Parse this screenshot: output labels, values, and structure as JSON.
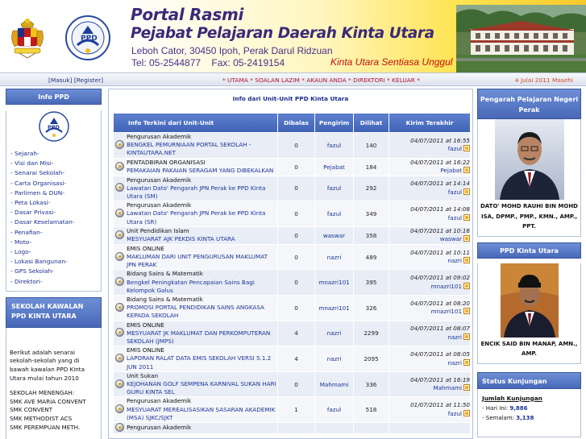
{
  "header": {
    "title": "Portal Rasmi",
    "subtitle": "Pejabat Pelajaran Daerah Kinta Utara",
    "address": "Leboh Cator, 30450 Ipoh, Perak Darul Ridzuan",
    "tel": "Tel: 05-2544877    Fax: 05-2419154",
    "motto": "Kinta Utara Sentiasa Unggul"
  },
  "nav": {
    "masuk": "[Masuk]",
    "register": "[Register]",
    "menu": [
      "* UTAMA",
      "* SOALAN LAZIM",
      "* AKAUN ANDA",
      "* DIREKTORI",
      "* KELUAR *"
    ],
    "date": "4 Julai 2011 Masehi"
  },
  "left": {
    "info_title": "Info PPD",
    "links": [
      "- Sejarah-",
      "- Visi dan Misi-",
      "- Senarai Sekolah-",
      "- Carta Organisasi-",
      "- Parlimen & DUN-",
      "- Peta Lokasi-",
      "- Dasar Privasi-",
      "- Dasar Keselamatan-",
      "- Penafian-",
      "- Moto-",
      "- Logo-",
      "- Lokasi Bangunan-",
      "- GPS Sekolah-",
      "- Direktori-"
    ],
    "sk_title": "SEKOLAH KAWALAN PPD KINTA UTARA",
    "sk_intro": "Berikut adalah senarai sekolah-sekolah yang di bawah kawalan PPD Kinta Utara mulai tahun 2010",
    "sk_sub": "SEKOLAH MENENGAH:",
    "sk_list": [
      "SMK AVE MARIA CONVENT",
      "SMK CONVENT",
      "SMK METHODIST ACS",
      "SMK PEREMPUAN METH."
    ]
  },
  "center": {
    "title": "Info dari Unit-Unit PPD Kinta Utara",
    "columns": [
      "Info Terkini dari Unit-Unit",
      "Dibalas",
      "Pengirim",
      "Dilihat",
      "Kirim Terakhir"
    ],
    "rows": [
      {
        "cat": "Pengurusan Akademik",
        "topic": "BENGKEL PEMURNIAAN PORTAL SEKOLAH - KINTAUTARA.NET",
        "dibalas": "0",
        "pengirim": "fazul",
        "dilihat": "140",
        "date": "04/07/2011 at 16:55",
        "by": "fazul"
      },
      {
        "cat": "PENTADBIRAN ORGANISASI",
        "topic": "PEMAKAIAN PAKAIAN SERAGAM YANG DIBEKALKAN",
        "dibalas": "0",
        "pengirim": "Pejabat",
        "dilihat": "184",
        "date": "04/07/2011 at 16:22",
        "by": "Pejabat"
      },
      {
        "cat": "Pengurusan Akademik",
        "topic": "Lawatan Dato' Pengarah JPN Perak ke PPD Kinta Utara (SM)",
        "dibalas": "0",
        "pengirim": "fazul",
        "dilihat": "292",
        "date": "04/07/2011 at 14:14",
        "by": "fazul"
      },
      {
        "cat": "Pengurusan Akademik",
        "topic": "Lawatan Dato' Pengarah JPN Perak ke PPD Kinta Utara (SR)",
        "dibalas": "0",
        "pengirim": "fazul",
        "dilihat": "349",
        "date": "04/07/2011 at 14:08",
        "by": "fazul"
      },
      {
        "cat": "Unit Pendidikan Islam",
        "topic": "MESYUARAT AJK PEKDIS KINTA UTARA",
        "dibalas": "0",
        "pengirim": "waswar",
        "dilihat": "358",
        "date": "04/07/2011 at 10:16",
        "by": "waswar"
      },
      {
        "cat": "EMIS ONLINE",
        "topic": "MAKLUMAN DARI UNIT PENGURUSAN MAKLUMAT JPN PERAK",
        "dibalas": "0",
        "pengirim": "nazri",
        "dilihat": "489",
        "date": "04/07/2011 at 10:11",
        "by": "nazri"
      },
      {
        "cat": "Bidang Sains & Matematik",
        "topic": "Bengkel Peningkatan Pencapaian Sains Bagi Kelompok Galus",
        "dibalas": "0",
        "pengirim": "mnazri101",
        "dilihat": "395",
        "date": "04/07/2011 at 09:02",
        "by": "mnazri101"
      },
      {
        "cat": "Bidang Sains & Matematik",
        "topic": "PROMOSI PORTAL PENDIDIKAN SAINS ANGKASA KEPADA SEKOLAH",
        "dibalas": "0",
        "pengirim": "mnazri101",
        "dilihat": "326",
        "date": "04/07/2011 at 08:20",
        "by": "mnazri101"
      },
      {
        "cat": "EMIS ONLINE",
        "topic": "MESYUARAT JK MAKLUMAT DAN PERKOMPUTERAN SEKOLAH (JMPS)",
        "dibalas": "4",
        "pengirim": "nazri",
        "dilihat": "2299",
        "date": "04/07/2011 at 08:07",
        "by": "nazri"
      },
      {
        "cat": "EMIS ONLINE",
        "topic": "LAPORAN RALAT DATA EMIS SEKOLAH VERSI 5.1.2 JUN 2011",
        "dibalas": "4",
        "pengirim": "nazri",
        "dilihat": "2095",
        "date": "04/07/2011 at 08:05",
        "by": "nazri"
      },
      {
        "cat": "Unit Sukan",
        "topic": "KEJOHANAN GOLF SEMPENA KARNIVAL SUKAN HARI GURU KINTA SEL",
        "dibalas": "0",
        "pengirim": "Mahmami",
        "dilihat": "336",
        "date": "04/07/2011 at 16:19",
        "by": "Mahmami"
      },
      {
        "cat": "Pengurusan Akademik",
        "topic": "MESYUARAT MEREALISASIKAN SASARAN AKADEMIK (MSA) SJKC/SJKT",
        "dibalas": "1",
        "pengirim": "fazul",
        "dilihat": "518",
        "date": "01/07/2011 at 11:50",
        "by": "fazul"
      },
      {
        "cat": "Pengurusan Akademik",
        "topic": "",
        "dibalas": "",
        "pengirim": "",
        "dilihat": "",
        "date": "",
        "by": ""
      }
    ]
  },
  "right": {
    "pengarah_title": "Pengarah Pelajaran Negeri Perak",
    "pengarah_name": "DATO' MOHD RAUHI BIN MOHD ISA, DPMP., PMP., KMN., AMP., PPT.",
    "ppd_title": "PPD Kinta Utara",
    "ppd_name": "ENCIK SAID BIN MANAP, AMN., AMP.",
    "stat_title": "Status Kunjungan",
    "jumlah_label": "Jumlah Kunjungan",
    "hari_label": "- Hari Ini:",
    "hari_value": "9,886",
    "semalam_label": "- Semalam:",
    "semalam_value": "3,138"
  }
}
